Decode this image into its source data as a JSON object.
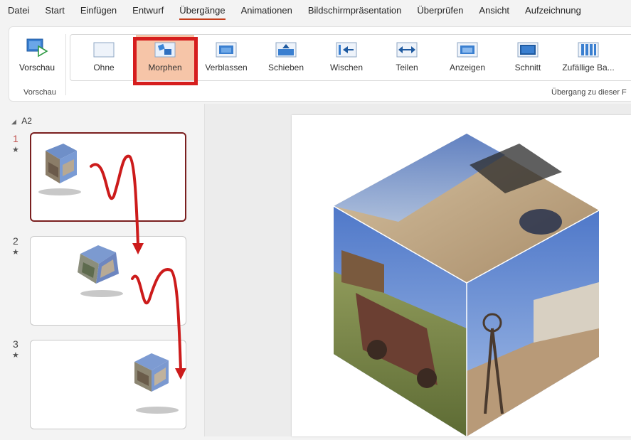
{
  "menu": {
    "items": [
      "Datei",
      "Start",
      "Einfügen",
      "Entwurf",
      "Übergänge",
      "Animationen",
      "Bildschirmpräsentation",
      "Überprüfen",
      "Ansicht",
      "Aufzeichnung"
    ],
    "active_index": 4
  },
  "ribbon": {
    "preview_label": "Vorschau",
    "preview_group_label": "Vorschau",
    "transitions_group_label": "Übergang zu dieser F",
    "effects": [
      {
        "label": "Ohne",
        "icon": "none-transition-icon"
      },
      {
        "label": "Morphen",
        "icon": "morph-transition-icon",
        "selected": true
      },
      {
        "label": "Verblassen",
        "icon": "fade-transition-icon"
      },
      {
        "label": "Schieben",
        "icon": "push-transition-icon"
      },
      {
        "label": "Wischen",
        "icon": "wipe-transition-icon"
      },
      {
        "label": "Teilen",
        "icon": "split-transition-icon"
      },
      {
        "label": "Anzeigen",
        "icon": "reveal-transition-icon"
      },
      {
        "label": "Schnitt",
        "icon": "cut-transition-icon"
      },
      {
        "label": "Zufällige Ba...",
        "icon": "random-bars-transition-icon"
      }
    ]
  },
  "slides_panel": {
    "section": "A2",
    "slides": [
      {
        "number": "1",
        "marker": "★",
        "current": true
      },
      {
        "number": "2",
        "marker": "★",
        "current": false
      },
      {
        "number": "3",
        "marker": "★",
        "current": false
      }
    ]
  },
  "colors": {
    "accent": "#c43e1c",
    "selected_effect": "#f6c5a8",
    "highlight_frame": "#d61e1e",
    "arrow": "#cc1b1b",
    "current_slide_border": "#7a1f1f"
  }
}
